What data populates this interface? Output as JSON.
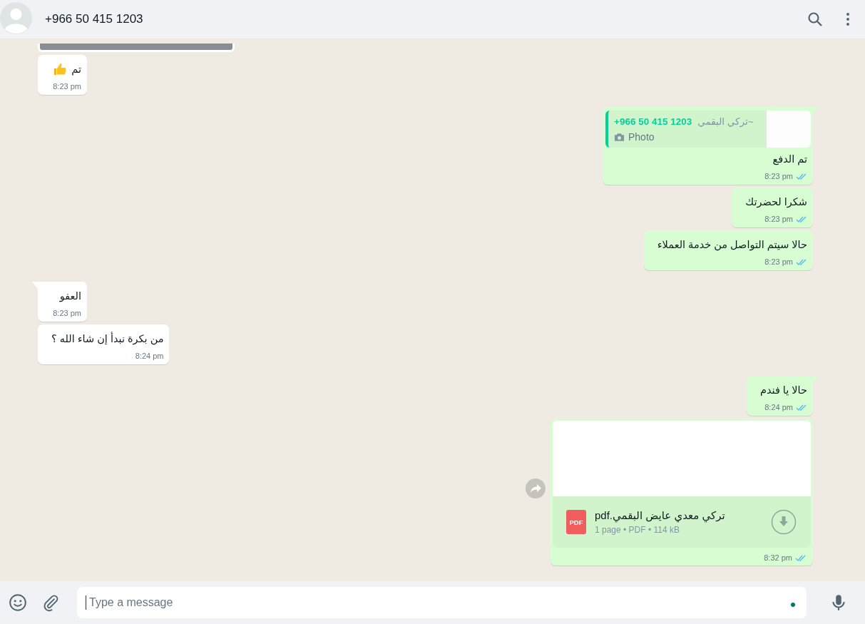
{
  "header": {
    "title": "+966 50 415 1203"
  },
  "messages": [
    {
      "kind": "image",
      "outgoing": false,
      "tail": false
    },
    {
      "kind": "emoji_text",
      "outgoing": false,
      "tail": false,
      "text": "تم",
      "time": "8:23 pm"
    },
    {
      "kind": "reply",
      "outgoing": true,
      "tail": true,
      "read": true,
      "quote": {
        "phone": "+966 50 415 1203",
        "alias": "~تركي البقمي",
        "label": "Photo"
      },
      "text": "تم الدفع",
      "time": "8:23 pm"
    },
    {
      "kind": "text",
      "outgoing": true,
      "tail": false,
      "read": true,
      "text": "شكرا لحضرتك",
      "time": "8:23 pm"
    },
    {
      "kind": "text",
      "outgoing": true,
      "tail": false,
      "read": true,
      "text": "حالا سيتم التواصل من خدمة العملاء",
      "time": "8:23 pm"
    },
    {
      "kind": "text",
      "outgoing": false,
      "tail": true,
      "text": "العفو",
      "time": "8:23 pm"
    },
    {
      "kind": "text",
      "outgoing": false,
      "tail": false,
      "text": "من بكرة نبدأ إن شاء الله ؟",
      "time": "8:24 pm"
    },
    {
      "kind": "text",
      "outgoing": true,
      "tail": true,
      "read": true,
      "text": "حالا يا فندم",
      "time": "8:24 pm"
    },
    {
      "kind": "document",
      "outgoing": true,
      "tail": false,
      "read": true,
      "file": {
        "badge": "PDF",
        "name": "تركي معدي عايض البقمي.pdf",
        "meta": "1 page • PDF • 114 kB"
      },
      "time": "8:32 pm"
    }
  ],
  "composer": {
    "placeholder": "Type a message"
  }
}
